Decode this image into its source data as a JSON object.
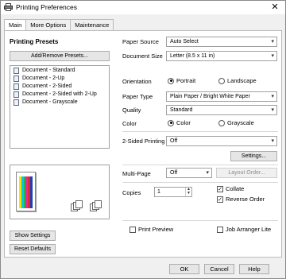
{
  "window": {
    "title": "Printing Preferences",
    "icon": "printer-icon"
  },
  "tabs": [
    {
      "label": "Main",
      "active": true
    },
    {
      "label": "More Options",
      "active": false
    },
    {
      "label": "Maintenance",
      "active": false
    }
  ],
  "presets": {
    "title": "Printing Presets",
    "add_remove_label": "Add/Remove Presets...",
    "items": [
      "Document - Standard",
      "Document - 2-Up",
      "Document - 2-Sided",
      "Document - 2-Sided with 2-Up",
      "Document - Grayscale"
    ]
  },
  "left_buttons": {
    "show_settings": "Show Settings",
    "reset_defaults": "Reset Defaults"
  },
  "settings": {
    "paper_source": {
      "label": "Paper Source",
      "value": "Auto Select"
    },
    "document_size": {
      "label": "Document Size",
      "value": "Letter (8.5 x 11 in)"
    },
    "orientation": {
      "label": "Orientation",
      "options": [
        "Portrait",
        "Landscape"
      ],
      "selected": "Portrait"
    },
    "paper_type": {
      "label": "Paper Type",
      "value": "Plain Paper / Bright White Paper"
    },
    "quality": {
      "label": "Quality",
      "value": "Standard"
    },
    "color": {
      "label": "Color",
      "options": [
        "Color",
        "Grayscale"
      ],
      "selected": "Color"
    },
    "two_sided": {
      "label": "2-Sided Printing",
      "value": "Off",
      "settings_button": "Settings..."
    },
    "multi_page": {
      "label": "Multi-Page",
      "value": "Off",
      "layout_button": "Layout Order..."
    },
    "copies": {
      "label": "Copies",
      "value": "1"
    },
    "collate": {
      "label": "Collate",
      "checked": true
    },
    "reverse_order": {
      "label": "Reverse Order",
      "checked": true
    },
    "print_preview": {
      "label": "Print Preview",
      "checked": false
    },
    "job_arranger": {
      "label": "Job Arranger Lite",
      "checked": false
    }
  },
  "dialog_buttons": {
    "ok": "OK",
    "cancel": "Cancel",
    "help": "Help"
  }
}
